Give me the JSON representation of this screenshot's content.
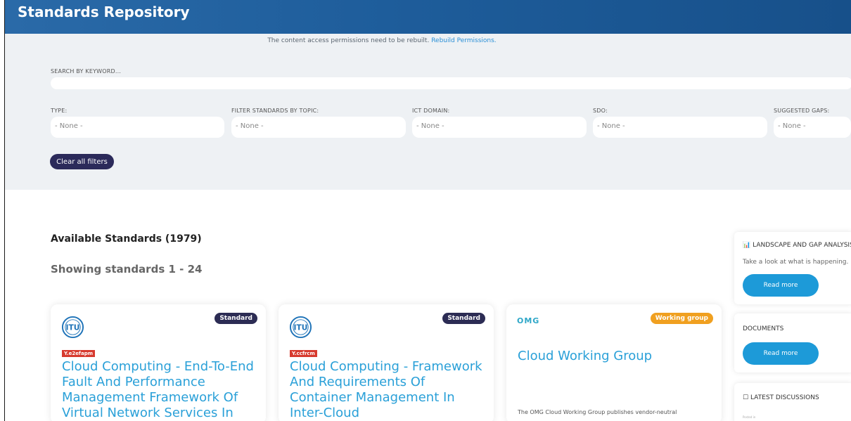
{
  "header": {
    "title": "Standards Repository"
  },
  "notice": {
    "text": "The content access permissions need to be rebuilt.",
    "link": "Rebuild Permissions."
  },
  "search": {
    "label": "SEARCH BY KEYWORD...",
    "value": ""
  },
  "filters": [
    {
      "label": "TYPE:",
      "value": "- None -"
    },
    {
      "label": "FILTER STANDARDS BY TOPIC:",
      "value": "- None -"
    },
    {
      "label": "ICT DOMAIN:",
      "value": "- None -"
    },
    {
      "label": "SDO:",
      "value": "- None -"
    },
    {
      "label": "SUGGESTED GAPS:",
      "value": "- None -"
    }
  ],
  "clear_filters": "Clear all filters",
  "results": {
    "available": "Available Standards (1979)",
    "showing": "Showing standards 1 - 24"
  },
  "cards": [
    {
      "badge": "Standard",
      "code": "Y.e2efapm",
      "logo": "ITU",
      "title": "Cloud Computing - End-To-End Fault And Performance Management Framework Of Virtual Network Services In"
    },
    {
      "badge": "Standard",
      "code": "Y.ccfrcm",
      "logo": "ITU",
      "title": "Cloud Computing - Framework And Requirements Of Container Management In Inter-Cloud"
    },
    {
      "badge": "Working group",
      "logo": "OMG",
      "title": "Cloud Working Group",
      "description": "The OMG Cloud Working Group publishes vendor-neutral"
    }
  ],
  "sidebar": {
    "landscape": {
      "title": "LANDSCAPE AND GAP ANALYSIS",
      "text": "Take a look at what is happening.",
      "button": "Read more"
    },
    "documents": {
      "title": "DOCUMENTS",
      "button": "Read more"
    },
    "discussions": {
      "title": "LATEST DISCUSSIONS",
      "posted": "Posted in"
    }
  },
  "colors": {
    "header_bg": "#1e5d9b",
    "accent": "#1d9ad8",
    "link": "#2aa0d8",
    "badge_standard": "#2c2c54",
    "badge_wg": "#f0a020",
    "code_tag": "#d73a2e"
  }
}
